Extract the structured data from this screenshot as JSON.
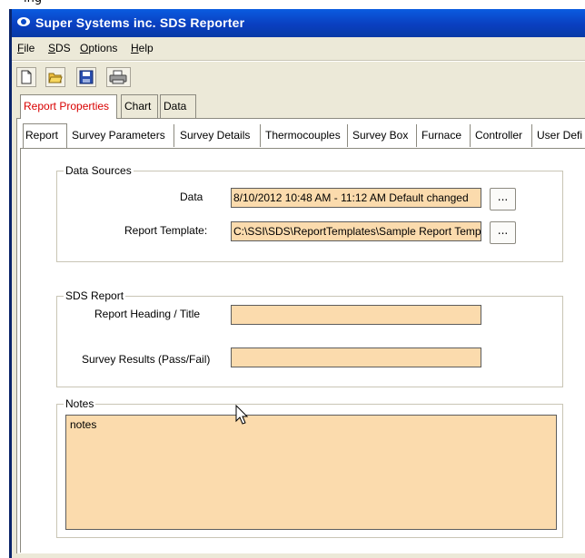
{
  "top_strip_text": "ing",
  "window": {
    "title": "Super Systems inc. SDS Reporter"
  },
  "menu": {
    "file": {
      "accel": "F",
      "rest": "ile"
    },
    "sds": {
      "accel": "S",
      "rest": "DS"
    },
    "options": {
      "accel": "O",
      "rest": "ptions"
    },
    "help": {
      "accel": "H",
      "rest": "elp"
    }
  },
  "toolbar": [
    "new-file-icon",
    "open-folder-icon",
    "save-disk-icon",
    "print-icon"
  ],
  "main_tabs": [
    "Report Properties",
    "Chart",
    "Data"
  ],
  "sub_tabs": [
    "Report",
    "Survey Parameters",
    "Survey Details",
    "Thermocouples",
    "Survey Box",
    "Furnace",
    "Controller",
    "User Defi"
  ],
  "data_sources": {
    "legend": "Data Sources",
    "data_label": "Data",
    "data_value": "8/10/2012 10:48 AM - 11:12 AM  Default changed",
    "template_label": "Report Template:",
    "template_value": "C:\\SSI\\SDS\\ReportTemplates\\Sample Report Template",
    "browse_label": "..."
  },
  "sds_report": {
    "legend": "SDS Report",
    "heading_label": "Report Heading / Title",
    "heading_value": "",
    "results_label": "Survey Results (Pass/Fail)",
    "results_value": ""
  },
  "notes": {
    "legend": "Notes",
    "value": "notes"
  },
  "colors": {
    "field_bg": "#fbdbad",
    "active_tab_text": "#d90000",
    "titlebar": "#0a49c8"
  }
}
